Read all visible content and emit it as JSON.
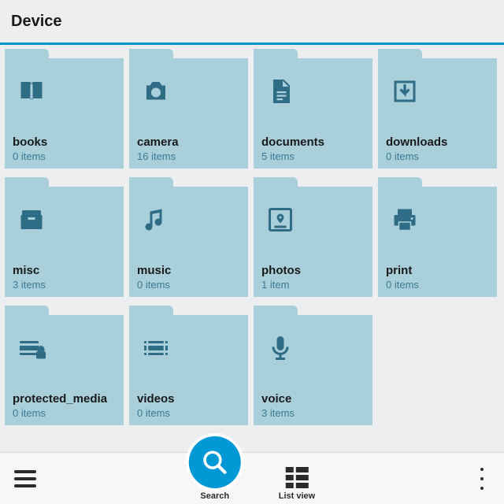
{
  "header": {
    "title": "Device"
  },
  "folders": [
    {
      "name": "books",
      "count": "0 items",
      "icon": "book"
    },
    {
      "name": "camera",
      "count": "16 items",
      "icon": "camera"
    },
    {
      "name": "documents",
      "count": "5 items",
      "icon": "document"
    },
    {
      "name": "downloads",
      "count": "0 items",
      "icon": "download"
    },
    {
      "name": "misc",
      "count": "3 items",
      "icon": "box"
    },
    {
      "name": "music",
      "count": "0 items",
      "icon": "music"
    },
    {
      "name": "photos",
      "count": "1 item",
      "icon": "photo"
    },
    {
      "name": "print",
      "count": "0 items",
      "icon": "print"
    },
    {
      "name": "protected_media",
      "count": "0 items",
      "icon": "protected"
    },
    {
      "name": "videos",
      "count": "0 items",
      "icon": "video"
    },
    {
      "name": "voice",
      "count": "3 items",
      "icon": "mic"
    }
  ],
  "bottombar": {
    "search_label": "Search",
    "listview_label": "List view"
  }
}
